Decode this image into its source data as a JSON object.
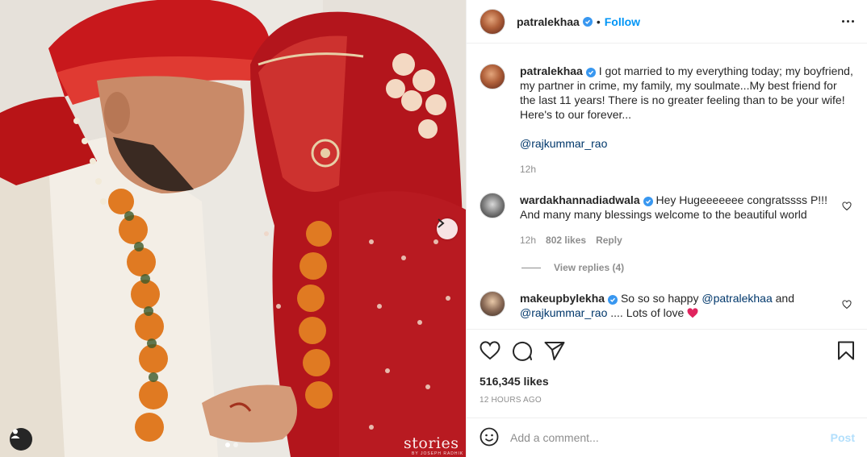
{
  "post": {
    "image_alt": "",
    "watermark": "stories",
    "watermark_sub": "BY JOSEPH RADHIK",
    "carousel_index": 1,
    "carousel_count": 2
  },
  "header": {
    "username": "patralekhaa",
    "separator": "•",
    "follow_label": "Follow"
  },
  "caption": {
    "username": "patralekhaa",
    "text": "I got married to my everything today; my boyfriend, my partner in crime, my family, my soulmate...My best friend for the last 11 years! There is no greater feeling than to be your wife! Here's to our forever...",
    "mention": "@rajkummar_rao",
    "time": "12h"
  },
  "comments": [
    {
      "username": "wardakhannadiadwala",
      "text": "Hey Hugeeeeeee congratssss P!!! And many many blessings welcome to the beautiful world",
      "time": "12h",
      "likes": "802 likes",
      "reply_label": "Reply",
      "view_replies": "View replies (4)"
    },
    {
      "username": "makeupbylekha",
      "text_before": "So so so happy ",
      "mention1": "@patralekhaa",
      "text_mid": " and ",
      "mention2": "@rajkummar_rao",
      "text_after": " .... Lots of love "
    }
  ],
  "actions": {
    "likes_count": "516,345 likes",
    "timestamp": "12 HOURS AGO"
  },
  "add_comment": {
    "placeholder": "Add a comment...",
    "post_label": "Post"
  },
  "colors": {
    "accent": "#0095f6",
    "verified": "#3897f0",
    "mention": "#00376b",
    "post_disabled": "#b2dffc",
    "heart_emoji": "#e0245e"
  }
}
